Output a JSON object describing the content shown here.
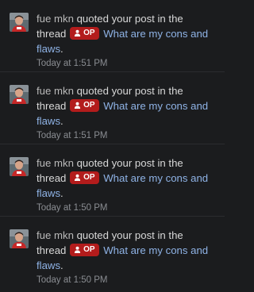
{
  "notifications": [
    {
      "user": "fue mkn",
      "action": "quoted your post in the",
      "context": "thread",
      "badge": "OP",
      "thread_title_part1": "What are my cons and",
      "thread_title_part2": "flaws",
      "timestamp": "Today at 1:51 PM"
    },
    {
      "user": "fue mkn",
      "action": "quoted your post in the",
      "context": "thread",
      "badge": "OP",
      "thread_title_part1": "What are my cons and",
      "thread_title_part2": "flaws",
      "timestamp": "Today at 1:51 PM"
    },
    {
      "user": "fue mkn",
      "action": "quoted your post in the",
      "context": "thread",
      "badge": "OP",
      "thread_title_part1": "What are my cons and",
      "thread_title_part2": "flaws",
      "timestamp": "Today at 1:50 PM"
    },
    {
      "user": "fue mkn",
      "action": "quoted your post in the",
      "context": "thread",
      "badge": "OP",
      "thread_title_part1": "What are my cons and",
      "thread_title_part2": "flaws",
      "timestamp": "Today at 1:50 PM"
    }
  ],
  "icons": {
    "badge_icon": "user-icon",
    "avatar": "avatar"
  },
  "colors": {
    "background": "#1b1c1e",
    "link": "#8fb3e6",
    "badge": "#b31c1c",
    "timestamp": "#8a8d92"
  }
}
